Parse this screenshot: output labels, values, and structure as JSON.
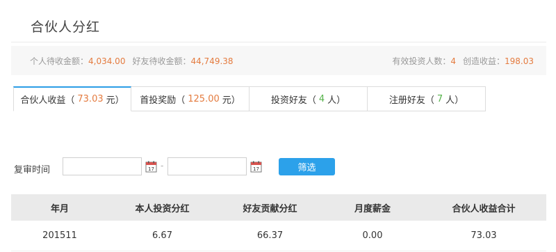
{
  "page": {
    "title": "合伙人分红"
  },
  "summary": {
    "self_pending_label": "个人待收金额：",
    "self_pending_value": "4,034.00",
    "friend_pending_label": "好友待收金额：",
    "friend_pending_value": "44,749.38",
    "valid_investors_label": "有效投资人数：",
    "valid_investors_value": "4",
    "created_income_label": "创造收益：",
    "created_income_value": "198.03"
  },
  "tabs": [
    {
      "label": "合伙人收益（",
      "value": "73.03",
      "unit": "元）"
    },
    {
      "label": "首投奖励（",
      "value": "125.00",
      "unit": "元）"
    },
    {
      "label": "投资好友（",
      "value": "4",
      "unit": "人）"
    },
    {
      "label": "注册好友（",
      "value": "7",
      "unit": "人）"
    }
  ],
  "filter": {
    "label": "复审时间",
    "start_value": "",
    "end_value": "",
    "separator": "-",
    "button_label": "筛选",
    "calendar_day": "17"
  },
  "table": {
    "headers": [
      "年月",
      "本人投资分红",
      "好友贡献分红",
      "月度薪金",
      "合伙人收益合计"
    ],
    "rows": [
      [
        "201511",
        "6.67",
        "66.37",
        "0.00",
        "73.03"
      ]
    ]
  },
  "colors": {
    "accent": "#2ca1ea",
    "amount_orange": "#e47b3f",
    "count_green": "#55b24a"
  }
}
